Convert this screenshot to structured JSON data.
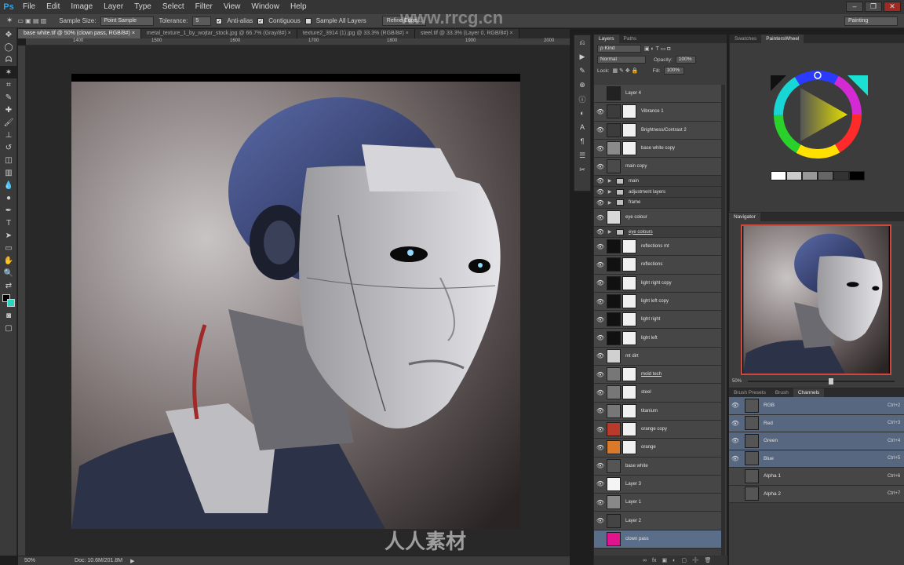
{
  "app": {
    "logo": "Ps"
  },
  "menu": [
    "File",
    "Edit",
    "Image",
    "Layer",
    "Type",
    "Select",
    "Filter",
    "View",
    "Window",
    "Help"
  ],
  "options_bar": {
    "sample_size_label": "Sample Size:",
    "sample_size_value": "Point Sample",
    "tolerance_label": "Tolerance:",
    "tolerance_value": "5",
    "antialias_label": "Anti-alias",
    "contiguous_label": "Contiguous",
    "sample_all_label": "Sample All Layers",
    "refine_edge_label": "Refine Edge...",
    "workspace": "Painting"
  },
  "doc_tabs": [
    "base white.tif @ 50% (clown pass, RGB/8#) ×",
    "metal_texture_1_by_wojtar_stock.jpg @ 66.7% (Gray/8#) ×",
    "texture2_3914 (1).jpg @ 33.3% (RGB/8#) ×",
    "steel.tif @ 33.3% (Layer 0, RGB/8#) ×"
  ],
  "rulers": {
    "top": [
      "1400",
      "1500",
      "1600",
      "1700",
      "1800",
      "1900",
      "2000"
    ]
  },
  "status": {
    "zoom": "50%",
    "doc": "Doc: 10.6M/201.8M"
  },
  "layers_panel": {
    "tabs": [
      "Layers",
      "Paths"
    ],
    "kind_label": "ρ Kind",
    "blend_mode": "Normal",
    "opacity_label": "Opacity:",
    "opacity_value": "100%",
    "lock_label": "Lock:",
    "fill_label": "Fill:",
    "fill_value": "100%",
    "layers": [
      {
        "name": "Layer 4",
        "type": "layer",
        "eye": false,
        "thumb": "#222222",
        "mask": false,
        "ul": false
      },
      {
        "name": "Vibrance 1",
        "type": "adjust",
        "eye": true,
        "thumb": "#3c3c3c",
        "mask": true,
        "ul": false
      },
      {
        "name": "Brightness/Contrast 2",
        "type": "adjust",
        "eye": true,
        "thumb": "#3c3c3c",
        "mask": true,
        "ul": false
      },
      {
        "name": "base white copy",
        "type": "layer",
        "eye": true,
        "thumb": "#8a8a8a",
        "mask": true,
        "ul": false
      },
      {
        "name": "main copy",
        "type": "layer",
        "eye": true,
        "thumb": "#4a4a4a",
        "mask": false,
        "ul": false
      },
      {
        "name": "main",
        "type": "group",
        "eye": true,
        "ul": false
      },
      {
        "name": "adjustment layers",
        "type": "group",
        "eye": true,
        "ul": false
      },
      {
        "name": "frame",
        "type": "group",
        "eye": true,
        "ul": false
      },
      {
        "name": "eye colour",
        "type": "layer",
        "eye": true,
        "thumb": "#d8d8d8",
        "mask": false,
        "ul": false
      },
      {
        "name": "eye colours",
        "type": "group",
        "eye": true,
        "ul": true
      },
      {
        "name": "reflections mt",
        "type": "layer",
        "eye": true,
        "thumb": "#111111",
        "mask": true,
        "ul": false
      },
      {
        "name": "reflections",
        "type": "layer",
        "eye": true,
        "thumb": "#111111",
        "mask": true,
        "ul": false
      },
      {
        "name": "light right copy",
        "type": "layer",
        "eye": true,
        "thumb": "#111111",
        "mask": true,
        "ul": false
      },
      {
        "name": "light left copy",
        "type": "layer",
        "eye": true,
        "thumb": "#111111",
        "mask": true,
        "ul": false
      },
      {
        "name": "light right",
        "type": "layer",
        "eye": true,
        "thumb": "#111111",
        "mask": true,
        "ul": false
      },
      {
        "name": "light left",
        "type": "layer",
        "eye": true,
        "thumb": "#111111",
        "mask": true,
        "ul": false
      },
      {
        "name": "mt dirt",
        "type": "layer",
        "eye": true,
        "thumb": "#d0d0d0",
        "mask": false,
        "ul": false
      },
      {
        "name": "mold tech",
        "type": "layer",
        "eye": true,
        "thumb": "#777777",
        "mask": true,
        "ul": true
      },
      {
        "name": "steel",
        "type": "layer",
        "eye": true,
        "thumb": "#777777",
        "mask": true,
        "ul": false
      },
      {
        "name": "titanium",
        "type": "layer",
        "eye": true,
        "thumb": "#777777",
        "mask": true,
        "ul": false
      },
      {
        "name": "orange copy",
        "type": "layer",
        "eye": true,
        "thumb": "#b83a2a",
        "mask": true,
        "ul": false
      },
      {
        "name": "orange",
        "type": "layer",
        "eye": true,
        "thumb": "#d87a2a",
        "mask": true,
        "ul": false
      },
      {
        "name": "base white",
        "type": "layer",
        "eye": true,
        "thumb": "#555555",
        "mask": false,
        "ul": false
      },
      {
        "name": "Layer 3",
        "type": "layer",
        "eye": true,
        "thumb": "#f4f4f4",
        "mask": false,
        "ul": false
      },
      {
        "name": "Layer 1",
        "type": "layer",
        "eye": true,
        "thumb": "#888888",
        "mask": false,
        "ul": false
      },
      {
        "name": "Layer 2",
        "type": "layer",
        "eye": true,
        "thumb": "#444444",
        "mask": false,
        "ul": false
      },
      {
        "name": "clown pass",
        "type": "layer",
        "eye": false,
        "thumb": "#e0148c",
        "mask": false,
        "ul": false,
        "selected": true
      }
    ],
    "footer": [
      "∞",
      "fx",
      "▣",
      "◐",
      "▢",
      "➕",
      "🗑"
    ]
  },
  "color_panel": {
    "tabs": [
      "Swatches",
      "PaintersWheel"
    ],
    "swatches": [
      "#ffffff",
      "#cccccc",
      "#999999",
      "#666666",
      "#333333",
      "#000000"
    ]
  },
  "navigator": {
    "title": "Navigator",
    "zoom": "50%"
  },
  "channels_panel": {
    "tabs": [
      "Brush Presets",
      "Brush",
      "Channels"
    ],
    "channels": [
      {
        "name": "RGB",
        "shortcut": "Ctrl+2",
        "eye": true,
        "selected": true
      },
      {
        "name": "Red",
        "shortcut": "Ctrl+3",
        "eye": true,
        "selected": true
      },
      {
        "name": "Green",
        "shortcut": "Ctrl+4",
        "eye": true,
        "selected": true
      },
      {
        "name": "Blue",
        "shortcut": "Ctrl+5",
        "eye": true,
        "selected": true
      },
      {
        "name": "Alpha 1",
        "shortcut": "Ctrl+6",
        "eye": false,
        "selected": false
      },
      {
        "name": "Alpha 2",
        "shortcut": "Ctrl+7",
        "eye": false,
        "selected": false
      }
    ]
  },
  "watermark": {
    "top": "www.rrcg.cn",
    "bottom": "人人素材"
  }
}
